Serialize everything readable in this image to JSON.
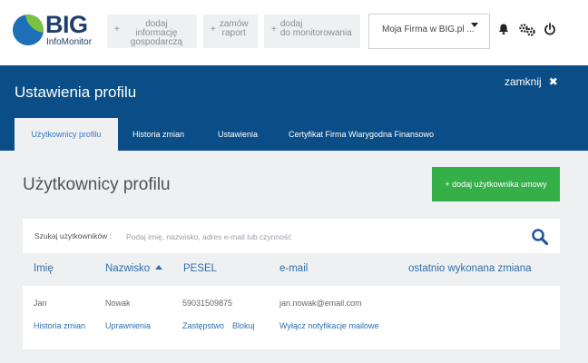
{
  "logo": {
    "big": "BIG",
    "sub": "InfoMonitor"
  },
  "toolbar": {
    "buttons": [
      {
        "plus": "+",
        "label": "dodaj informację\ngospodarczą"
      },
      {
        "plus": "+",
        "label": "zamów\nraport"
      },
      {
        "plus": "+",
        "label": "dodaj\ndo monitorowania"
      }
    ],
    "company_select": "Moja Firma w BIG.pl ..."
  },
  "icons": {
    "bell": "bell-icon",
    "gear": "gears-icon",
    "power": "power-icon",
    "search": "search-icon",
    "close": "close-icon"
  },
  "header": {
    "title": "Ustawienia profilu",
    "close_label": "zamknij",
    "close_glyph": "✖"
  },
  "tabs": [
    {
      "label": "Użytkownicy profilu",
      "active": true
    },
    {
      "label": "Historia zmian",
      "active": false
    },
    {
      "label": "Ustawienia",
      "active": false
    },
    {
      "label": "Certyfikat Firma Wiarygodna Finansowo",
      "active": false
    }
  ],
  "main": {
    "section_title": "Użytkownicy profilu",
    "add_button": "+  dodaj użytkownika umowy",
    "search": {
      "label": "Szukaj użytkowników :",
      "placeholder": "Podaj imię, nazwisko, adres e-mail lub czynność"
    },
    "columns": [
      "Imię",
      "Nazwisko",
      "PESEL",
      "e-mail",
      "ostatnio wykonana zmiana"
    ],
    "rows": [
      {
        "first_name": "Jan",
        "last_name": "Nowak",
        "pesel": "59031509875",
        "email": "jan.nowak@email.com",
        "last_change": "",
        "actions": {
          "history": "Historia zmian",
          "permissions": "Uprawnienia",
          "substitute": "Zastępstwo",
          "block": "Blokuj",
          "notifications": "Wyłącz notyfikacje mailowe"
        }
      }
    ]
  },
  "colors": {
    "header_bg": "#0b4e87",
    "accent_green": "#35b049",
    "link_blue": "#2f6fae",
    "page_bg": "#eef0f2"
  }
}
